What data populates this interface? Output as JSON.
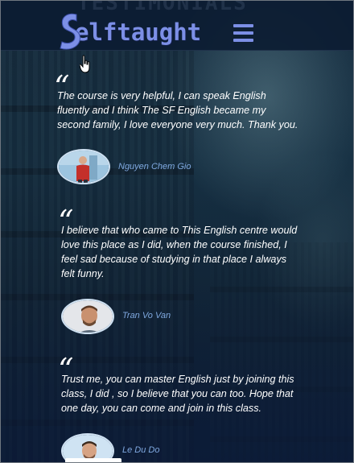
{
  "header": {
    "ghost_title": "TESTIMONIALS",
    "brand_initial": "S",
    "brand_rest": "elftaught",
    "menu_icon": "hamburger-menu-icon",
    "brand_color": "#7c8fe6"
  },
  "testimonials": [
    {
      "quote_glyph": "“",
      "text": "The course is very helpful, I can speak English fluently and I think The SF English became my second family, I love everyone very much. Thank you.",
      "author": "Nguyen Chem Gio"
    },
    {
      "quote_glyph": "“",
      "text": "I believe that who came to This English centre would love this place as I did, when the course finished, I feel sad because of studying in that place I always felt funny.",
      "author": "Tran Vo Van"
    },
    {
      "quote_glyph": "“",
      "text": "Trust me, you can master English just by joining this class, I did , so I believe that you can too. Hope that one day, you can come and join in this class.",
      "author": "Le Du Do"
    }
  ],
  "colors": {
    "text": "#ffffff",
    "author_name": "#7fa8df",
    "background": "#1a3346"
  }
}
